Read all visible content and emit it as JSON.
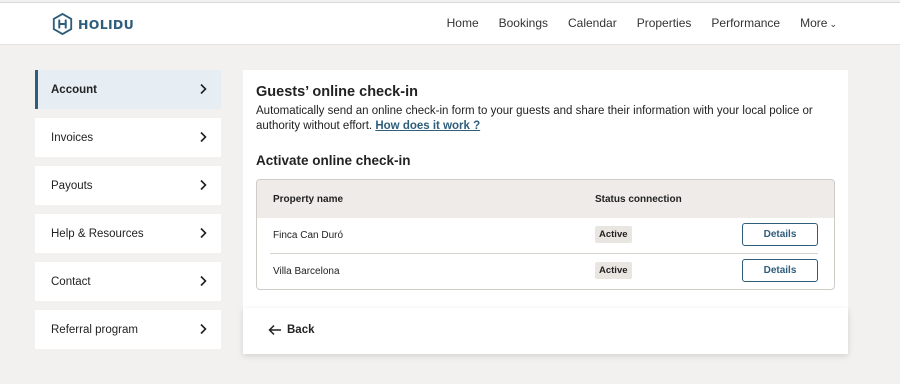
{
  "brand": {
    "name": "HOLIDU",
    "color": "#2f5d7c"
  },
  "nav": {
    "items": [
      "Home",
      "Bookings",
      "Calendar",
      "Properties",
      "Performance"
    ],
    "more_label": "More"
  },
  "sidebar": {
    "items": [
      {
        "label": "Account",
        "active": true
      },
      {
        "label": "Invoices"
      },
      {
        "label": "Payouts"
      },
      {
        "label": "Help & Resources"
      },
      {
        "label": "Contact"
      },
      {
        "label": "Referral program"
      }
    ]
  },
  "main": {
    "title": "Guests’ online check-in",
    "description": "Automatically send an online check-in form to your guests and share their information with your local police or authority without effort.",
    "link_label": "How does it work ?",
    "subtitle": "Activate online check-in",
    "table": {
      "headers": [
        "Property name",
        "Status connection"
      ],
      "rows": [
        {
          "name": "Finca Can Duró",
          "status": "Active",
          "action": "Details"
        },
        {
          "name": "Villa Barcelona",
          "status": "Active",
          "action": "Details"
        }
      ]
    }
  },
  "footer": {
    "back_label": "Back"
  }
}
